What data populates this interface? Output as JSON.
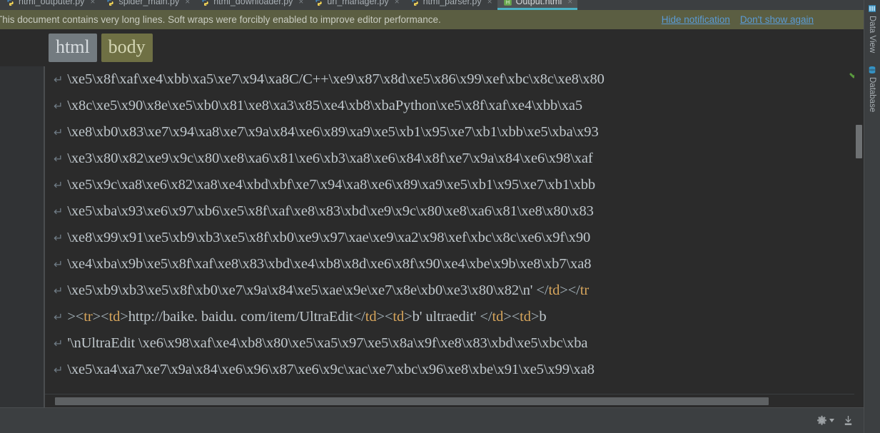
{
  "tabs": [
    {
      "label": "html_outputer.py",
      "icon": "python-file-icon",
      "active": false,
      "closable": true
    },
    {
      "label": "spider_main.py",
      "icon": "python-file-icon",
      "active": false,
      "closable": true
    },
    {
      "label": "html_downloader.py",
      "icon": "python-file-icon",
      "active": false,
      "closable": true
    },
    {
      "label": "url_manager.py",
      "icon": "python-file-icon",
      "active": false,
      "closable": true
    },
    {
      "label": "html_parser.py",
      "icon": "python-file-icon",
      "active": false,
      "closable": true
    },
    {
      "label": "Output.html",
      "icon": "html-file-icon",
      "active": true,
      "closable": true
    }
  ],
  "notification": {
    "message": "This document contains very long lines. Soft wraps were forcibly enabled to improve editor performance.",
    "hide_label": "Hide notification",
    "dismiss_label": "Don't show again",
    "background": "#5b5e42",
    "link_color": "#5b9bd5"
  },
  "breadcrumb": [
    {
      "label": "html",
      "style": "html"
    },
    {
      "label": "body",
      "style": "body"
    }
  ],
  "editor": {
    "wrap_arrow": "↵",
    "inspection_status": "green-check-icon",
    "lines": [
      {
        "segments": [
          {
            "text": "\\xe5\\x8f\\xaf\\xe4\\xbb\\xa5\\xe7\\x94\\xa8C/C++\\xe9\\x87\\x8d\\xe5\\x86\\x99\\xef\\xbc\\x8c\\xe8\\x80",
            "type": "plain"
          }
        ]
      },
      {
        "segments": [
          {
            "text": "\\x8c\\xe5\\x90\\x8e\\xe5\\xb0\\x81\\xe8\\xa3\\x85\\xe4\\xb8\\xbaPython\\xe5\\x8f\\xaf\\xe4\\xbb\\xa5",
            "type": "plain"
          }
        ]
      },
      {
        "segments": [
          {
            "text": "\\xe8\\xb0\\x83\\xe7\\x94\\xa8\\xe7\\x9a\\x84\\xe6\\x89\\xa9\\xe5\\xb1\\x95\\xe7\\xb1\\xbb\\xe5\\xba\\x93",
            "type": "plain"
          }
        ]
      },
      {
        "segments": [
          {
            "text": "\\xe3\\x80\\x82\\xe9\\x9c\\x80\\xe8\\xa6\\x81\\xe6\\xb3\\xa8\\xe6\\x84\\x8f\\xe7\\x9a\\x84\\xe6\\x98\\xaf",
            "type": "plain"
          }
        ]
      },
      {
        "segments": [
          {
            "text": "\\xe5\\x9c\\xa8\\xe6\\x82\\xa8\\xe4\\xbd\\xbf\\xe7\\x94\\xa8\\xe6\\x89\\xa9\\xe5\\xb1\\x95\\xe7\\xb1\\xbb",
            "type": "plain"
          }
        ]
      },
      {
        "segments": [
          {
            "text": "\\xe5\\xba\\x93\\xe6\\x97\\xb6\\xe5\\x8f\\xaf\\xe8\\x83\\xbd\\xe9\\x9c\\x80\\xe8\\xa6\\x81\\xe8\\x80\\x83",
            "type": "plain"
          }
        ]
      },
      {
        "segments": [
          {
            "text": "\\xe8\\x99\\x91\\xe5\\xb9\\xb3\\xe5\\x8f\\xb0\\xe9\\x97\\xae\\xe9\\xa2\\x98\\xef\\xbc\\x8c\\xe6\\x9f\\x90",
            "type": "plain"
          }
        ]
      },
      {
        "segments": [
          {
            "text": "\\xe4\\xba\\x9b\\xe5\\x8f\\xaf\\xe8\\x83\\xbd\\xe4\\xb8\\x8d\\xe6\\x8f\\x90\\xe4\\xbe\\x9b\\xe8\\xb7\\xa8",
            "type": "plain"
          }
        ]
      },
      {
        "segments": [
          {
            "text": "\\xe5\\xb9\\xb3\\xe5\\x8f\\xb0\\xe7\\x9a\\x84\\xe5\\xae\\x9e\\xe7\\x8e\\xb0\\xe3\\x80\\x82\\n'",
            "type": "plain"
          },
          {
            "text": " </",
            "type": "br"
          },
          {
            "text": "td",
            "type": "tag"
          },
          {
            "text": "></",
            "type": "br"
          },
          {
            "text": "tr",
            "type": "tag"
          }
        ]
      },
      {
        "segments": [
          {
            "text": "><",
            "type": "br"
          },
          {
            "text": "tr",
            "type": "tag"
          },
          {
            "text": "><",
            "type": "br"
          },
          {
            "text": "td",
            "type": "tag"
          },
          {
            "text": ">",
            "type": "br"
          },
          {
            "text": "http://baike. baidu. com/item/UltraEdit",
            "type": "plain"
          },
          {
            "text": "</",
            "type": "br"
          },
          {
            "text": "td",
            "type": "tag"
          },
          {
            "text": "><",
            "type": "br"
          },
          {
            "text": "td",
            "type": "tag"
          },
          {
            "text": ">",
            "type": "br"
          },
          {
            "text": "b' ultraedit' ",
            "type": "plain"
          },
          {
            "text": "</",
            "type": "br"
          },
          {
            "text": "td",
            "type": "tag"
          },
          {
            "text": "><",
            "type": "br"
          },
          {
            "text": "td",
            "type": "tag"
          },
          {
            "text": ">",
            "type": "br"
          },
          {
            "text": "b",
            "type": "plain"
          }
        ]
      },
      {
        "segments": [
          {
            "text": "'\\nUltraEdit \\xe6\\x98\\xaf\\xe4\\xb8\\x80\\xe5\\xa5\\x97\\xe5\\x8a\\x9f\\xe8\\x83\\xbd\\xe5\\xbc\\xba",
            "type": "plain"
          }
        ]
      },
      {
        "segments": [
          {
            "text": "\\xe5\\xa4\\xa7\\xe7\\x9a\\x84\\xe6\\x96\\x87\\xe6\\x9c\\xac\\xe7\\xbc\\x96\\xe8\\xbe\\x91\\xe5\\x99\\xa8",
            "type": "plain"
          }
        ]
      }
    ]
  },
  "statusbar": {
    "items": [
      {
        "name": "settings-gear",
        "icon": "gear-icon"
      },
      {
        "name": "install-plugin",
        "icon": "download-icon"
      }
    ]
  },
  "right_sidebar": {
    "tools": [
      {
        "label": "Data View",
        "icon": "data-view-icon"
      },
      {
        "label": "Database",
        "icon": "database-icon"
      }
    ]
  },
  "colors": {
    "editor_background": "#2b2b2b",
    "chrome_background": "#3c3f41",
    "tab_active_background": "#4e5254",
    "tab_active_underline": "#4ab0c4",
    "notification_background": "#5b5e42",
    "tag_color": "#d6a55c",
    "text_color": "#bfc7cc"
  }
}
